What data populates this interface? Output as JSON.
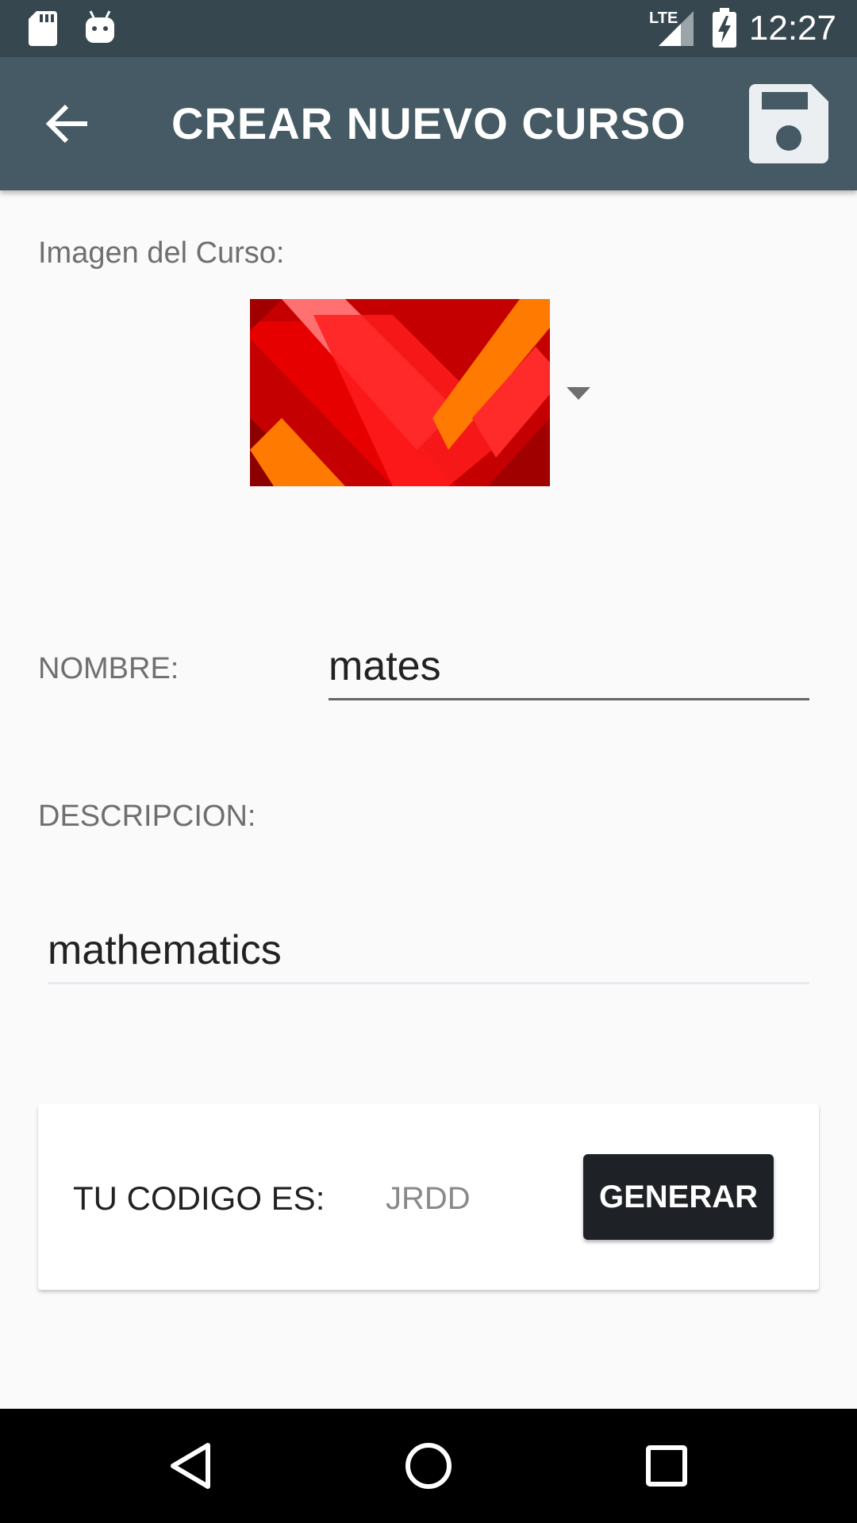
{
  "status_bar": {
    "time": "12:27",
    "network": "LTE",
    "icons": [
      "sd-card-icon",
      "android-icon",
      "lte-signal-icon",
      "battery-charging-icon"
    ]
  },
  "app_bar": {
    "title": "CREAR NUEVO CURSO",
    "back_icon": "arrow-back-icon",
    "save_icon": "save-icon"
  },
  "form": {
    "image_label": "Imagen del Curso:",
    "name_label": "NOMBRE:",
    "name_value": "mates",
    "description_label": "DESCRIPCION:",
    "description_value": "mathematics"
  },
  "code_card": {
    "label": "TU CODIGO ES:",
    "code": "JRDD",
    "generate_label": "GENERAR"
  },
  "nav_bar": {
    "icons": [
      "back-triangle-icon",
      "home-circle-icon",
      "recents-square-icon"
    ]
  },
  "colors": {
    "status_bar": "#37474f",
    "app_bar": "#455a64",
    "background": "#fafafa",
    "button": "#1e2226"
  }
}
